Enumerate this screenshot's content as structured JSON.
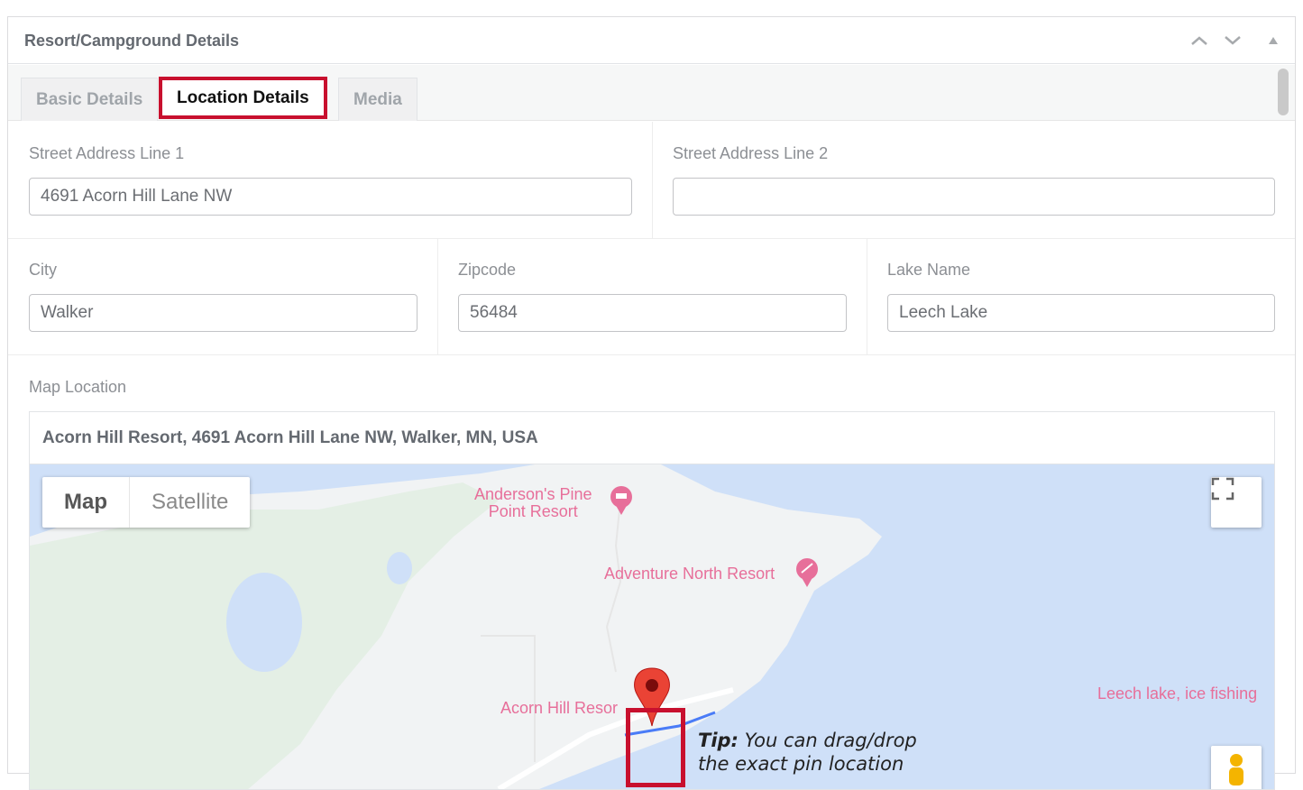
{
  "panel": {
    "title": "Resort/Campground Details",
    "controls": [
      "chevron-up-icon",
      "chevron-down-icon",
      "triangle-up-icon"
    ]
  },
  "tabs": [
    {
      "label": "Basic Details",
      "active": false
    },
    {
      "label": "Location Details",
      "active": true
    },
    {
      "label": "Media",
      "active": false
    }
  ],
  "fields": {
    "street1": {
      "label": "Street Address Line 1",
      "value": "4691 Acorn Hill Lane NW"
    },
    "street2": {
      "label": "Street Address Line 2",
      "value": ""
    },
    "city": {
      "label": "City",
      "value": "Walker"
    },
    "zipcode": {
      "label": "Zipcode",
      "value": "56484"
    },
    "lake": {
      "label": "Lake Name",
      "value": "Leech Lake"
    }
  },
  "map": {
    "label": "Map Location",
    "search_value": "Acorn Hill Resort, 4691 Acorn Hill Lane NW, Walker, MN, USA",
    "map_type": {
      "map": "Map",
      "satellite": "Satellite",
      "selected": "Map"
    },
    "pois": {
      "anderson_line1": "Anderson's Pine",
      "anderson_line2": "Point Resort",
      "adventure": "Adventure North Resort",
      "acorn": "Acorn Hill Resor",
      "leech": "Leech lake, ice fishing"
    },
    "tip_bold": "Tip:",
    "tip_line1": " You can drag/drop",
    "tip_line2": "the exact pin location",
    "colors": {
      "water": "#cfe0f8",
      "land": "#f1f3f4",
      "park": "#e4efe5",
      "highlight": "#c8102e",
      "poi": "#e76f9a"
    }
  }
}
